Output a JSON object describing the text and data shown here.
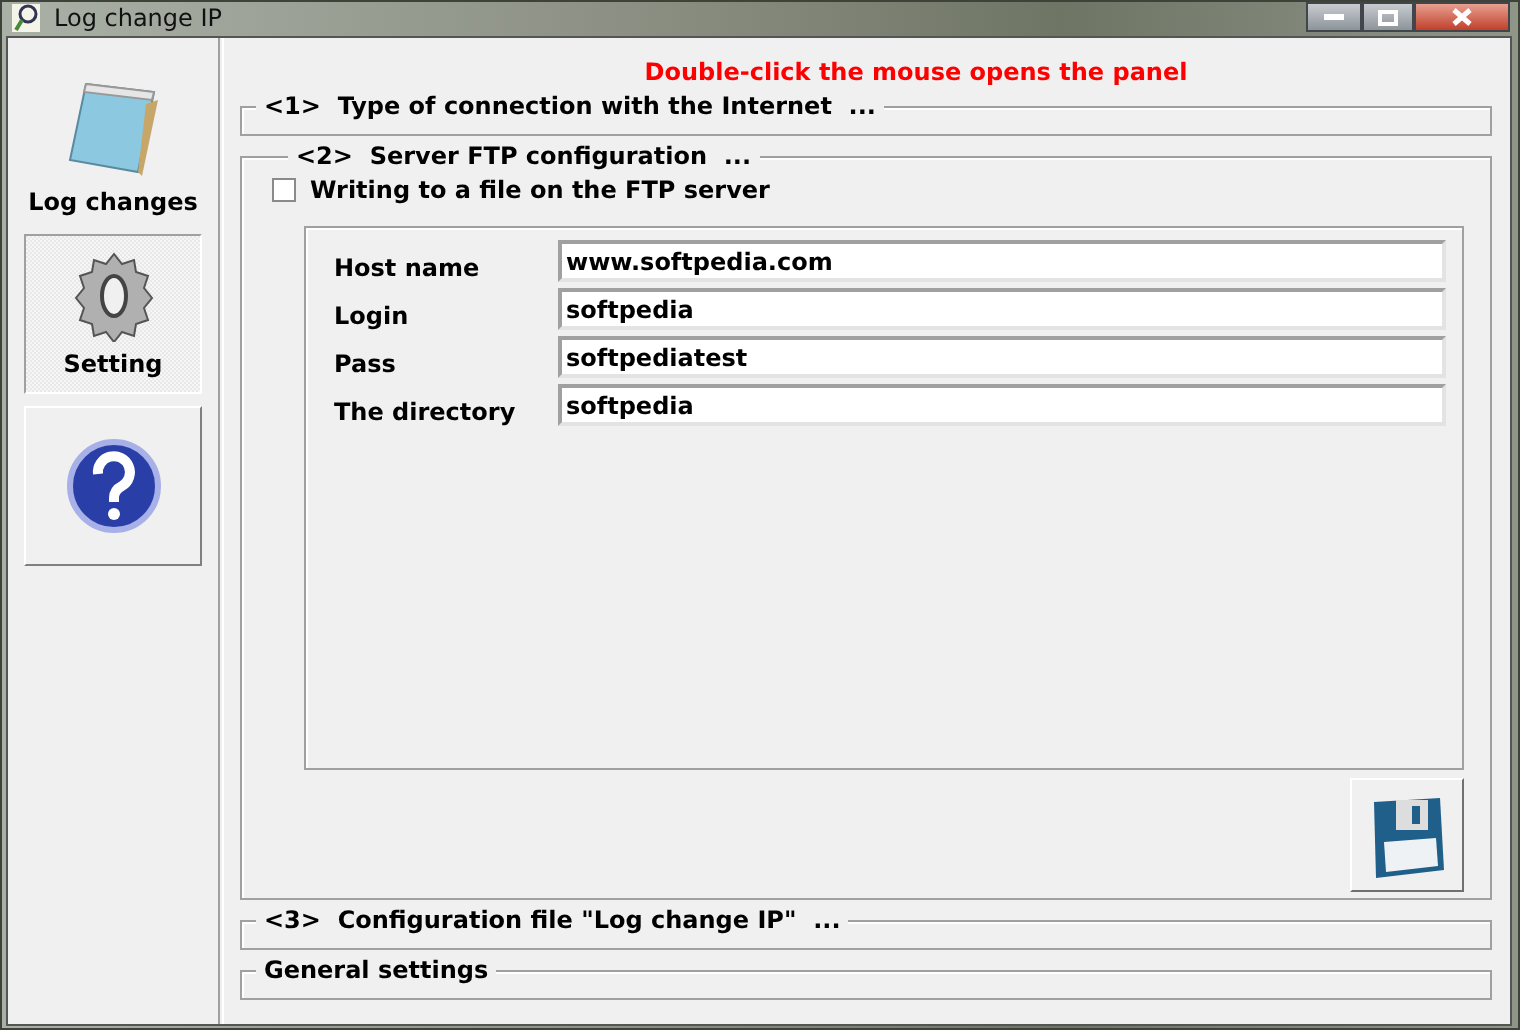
{
  "window": {
    "title": "Log change IP"
  },
  "hint": "Double-click the mouse opens the panel",
  "sidebar": [
    {
      "kind": "notepad",
      "label": "Log changes",
      "selected": false
    },
    {
      "kind": "gear",
      "label": "Setting",
      "selected": true
    },
    {
      "kind": "help",
      "selected": false
    }
  ],
  "sections": [
    {
      "label": "<1>  Type of connection with the Internet  ...",
      "expanded": false
    },
    {
      "label": "<2>  Server FTP configuration  ...",
      "expanded": true
    },
    {
      "label": "<3>  Configuration file \"Log change IP\"  ...",
      "expanded": false
    },
    {
      "label": "General settings",
      "expanded": false
    }
  ],
  "ftp": {
    "checkbox": {
      "label": "Writing to a file on the FTP server",
      "checked": false
    },
    "fields": [
      {
        "label": "Host name",
        "value": "www.softpedia.com"
      },
      {
        "label": "Login",
        "value": "softpedia"
      },
      {
        "label": "Pass",
        "value": "softpediatest"
      },
      {
        "label": "The directory",
        "value": "softpedia"
      }
    ]
  }
}
